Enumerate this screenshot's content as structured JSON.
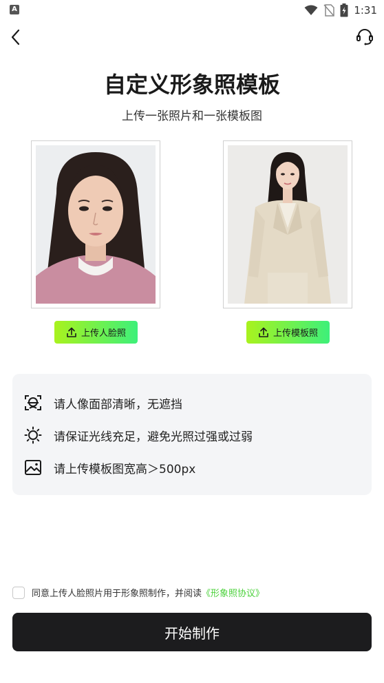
{
  "status_bar": {
    "badge": "A",
    "time": "1:31",
    "icons": [
      "wifi-icon",
      "no-sim-icon",
      "battery-charging-icon"
    ]
  },
  "nav": {
    "back_icon": "chevron-left-icon",
    "support_icon": "headset-icon"
  },
  "header": {
    "title": "自定义形象照模板",
    "subtitle": "上传一张照片和一张模板图"
  },
  "uploads": {
    "face_button": "上传人脸照",
    "template_button": "上传模板照",
    "icon": "upload-icon"
  },
  "tips": [
    {
      "icon": "face-scan-icon",
      "text": "请人像面部清晰，无遮挡"
    },
    {
      "icon": "sun-icon",
      "text": "请保证光线充足，避免光照过强或过弱"
    },
    {
      "icon": "image-icon",
      "text": "请上传模板图宽高＞500px"
    }
  ],
  "agreement": {
    "checked": false,
    "text": "同意上传人脸照片用于形象照制作，并阅读",
    "link": "《形象照协议》"
  },
  "primary_action": {
    "label": "开始制作"
  },
  "colors": {
    "accent_green": "#4bd13b",
    "button_gradient_start": "#a9f21e",
    "button_gradient_end": "#3df07a",
    "primary_button_bg": "#1c1c1e",
    "tips_bg": "#f4f5f7"
  }
}
